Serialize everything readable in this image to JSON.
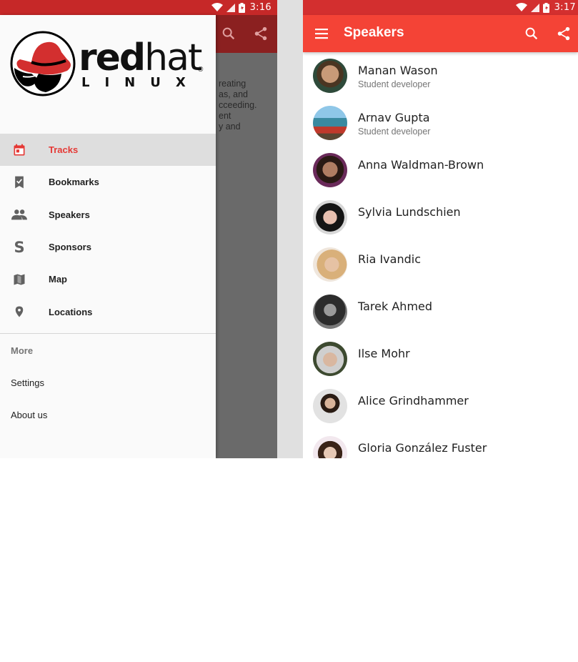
{
  "left_screen": {
    "status_time": "3:16",
    "peek_text": "reating\nas, and\ncceeding.\nent\ny and",
    "brand": {
      "word_bold": "red",
      "word_light": "hat",
      "sub": "LINUX",
      "reg": "®"
    },
    "nav_items": [
      {
        "label": "Tracks",
        "icon": "calendar-icon",
        "active": true
      },
      {
        "label": "Bookmarks",
        "icon": "bookmark-check-icon",
        "active": false
      },
      {
        "label": "Speakers",
        "icon": "people-icon",
        "active": false
      },
      {
        "label": "Sponsors",
        "icon": "dollar-icon",
        "active": false
      },
      {
        "label": "Map",
        "icon": "map-icon",
        "active": false
      },
      {
        "label": "Locations",
        "icon": "location-pin-icon",
        "active": false
      }
    ],
    "more_header": "More",
    "more_items": [
      {
        "label": "Settings"
      },
      {
        "label": "About us"
      }
    ]
  },
  "right_screen": {
    "status_time": "3:17",
    "title": "Speakers",
    "speakers": [
      {
        "name": "Manan Wason",
        "role": "Student developer"
      },
      {
        "name": "Arnav Gupta",
        "role": "Student developer"
      },
      {
        "name": "Anna Waldman-Brown",
        "role": ""
      },
      {
        "name": "Sylvia Lundschien",
        "role": ""
      },
      {
        "name": "Ria Ivandic",
        "role": ""
      },
      {
        "name": "Tarek Ahmed",
        "role": ""
      },
      {
        "name": "Ilse Mohr",
        "role": ""
      },
      {
        "name": "Alice Grindhammer",
        "role": ""
      },
      {
        "name": "Gloria González Fuster",
        "role": ""
      }
    ]
  },
  "colors": {
    "primary": "#f44336",
    "primary_dark": "#d32f2f",
    "active_nav": "#e53935",
    "drawer_bg": "#fafafa",
    "scrim": "#6a6a6a"
  }
}
